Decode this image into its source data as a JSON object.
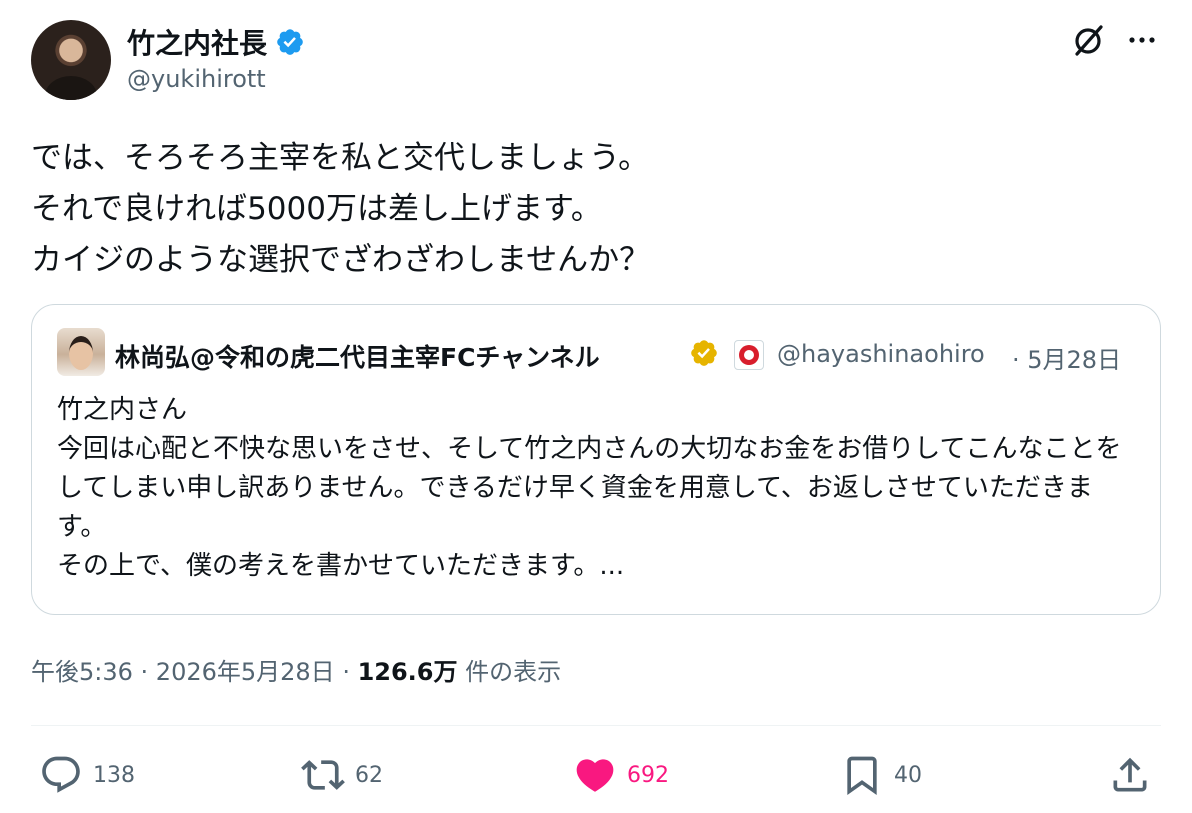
{
  "author": {
    "display_name": "竹之内社長",
    "handle": "@yukihirott",
    "verified_color": "#1d9bf0"
  },
  "icons": {
    "grok": "grok-slash-icon",
    "more": "more-dots-icon"
  },
  "tweet": {
    "text": "では、そろそろ主宰を私と交代しましょう。\nそれで良ければ5000万は差し上げます。\nカイジのような選択でざわざわしませんか？"
  },
  "quote": {
    "display_name": "林尚弘@令和の虎二代目主宰FCチャンネル",
    "handle": "@hayashinaohiro",
    "separator_date": "· 5月28日",
    "badge_color": "#e6b400",
    "text": "竹之内さん\n今回は心配と不快な思いをさせ、そして竹之内さんの大切なお金をお借りしてこんなことをしてしまい申し訳ありません。できるだけ早く資金を用意して、お返しさせていただきます。\nその上で、僕の考えを書かせていただきます。..."
  },
  "meta": {
    "time": "午後5:36",
    "sep1": " · ",
    "date": "2026年5月28日",
    "sep2": " · ",
    "views": "126.6万",
    "views_label": " 件の表示"
  },
  "actions": {
    "replies": "138",
    "retweets": "62",
    "likes": "692",
    "bookmarks": "40",
    "like_color": "#f91880"
  }
}
